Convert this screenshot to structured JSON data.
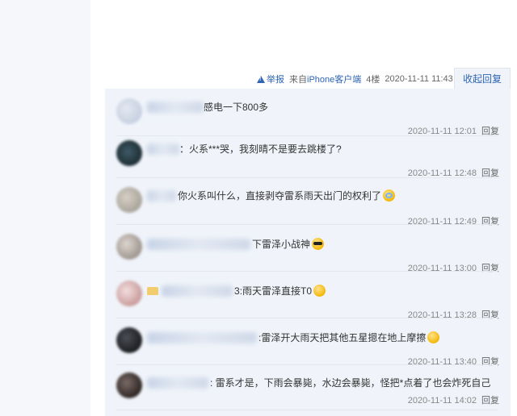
{
  "post_meta": {
    "report_label": "举报",
    "source_label": "来自",
    "source_link": "iPhone客户端",
    "floor": "4楼",
    "time": "2020-11-11 11:43",
    "collapse_label": "收起回复"
  },
  "comments": [
    {
      "text": "感电一下800多",
      "time": "2020-11-11 12:01",
      "reply": "回复"
    },
    {
      "text": "：火系***哭，我刻晴不是要去跳楼了?",
      "time": "2020-11-11 12:48",
      "reply": "回复"
    },
    {
      "text": "你火系叫什么，直接剥夺雷系雨天出门的权利了",
      "time": "2020-11-11 12:49",
      "reply": "回复"
    },
    {
      "text": "下雷泽小战神",
      "time": "2020-11-11 13:00",
      "reply": "回复"
    },
    {
      "text": "3:雨天雷泽直接T0",
      "time": "2020-11-11 13:28",
      "reply": "回复"
    },
    {
      "text": ":雷泽开大雨天把其他五星摁在地上摩擦",
      "time": "2020-11-11 13:40",
      "reply": "回复"
    },
    {
      "text": ": 雷系才是，下雨会暴毙，水边会暴毙，怪把*点着了也会炸死自己",
      "time": "2020-11-11 14:02",
      "reply": "回复"
    }
  ],
  "icons": {
    "report": "warning-triangle-icon",
    "emoji_cry": "crying-emoji-icon",
    "emoji_cool": "sunglasses-emoji-icon",
    "emoji_smile": "smile-emoji-icon",
    "emoji_grin": "grin-emoji-icon"
  },
  "colors": {
    "link": "#2d64b3",
    "reply_bg": "#f0f4fa",
    "page_gutter": "#f5f7fa"
  }
}
